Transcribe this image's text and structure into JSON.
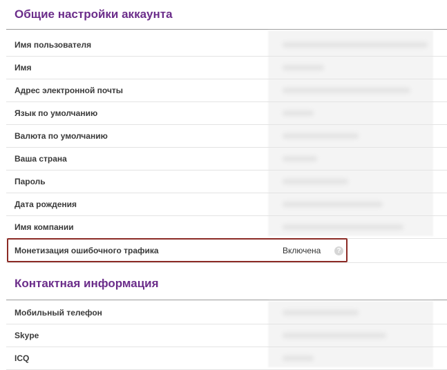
{
  "account_section": {
    "title": "Общие настройки аккаунта",
    "rows": [
      {
        "label": "Имя пользователя"
      },
      {
        "label": "Имя"
      },
      {
        "label": "Адрес электронной почты"
      },
      {
        "label": "Язык по умолчанию"
      },
      {
        "label": "Валюта по умолчанию"
      },
      {
        "label": "Ваша страна"
      },
      {
        "label": "Пароль"
      },
      {
        "label": "Дата рождения"
      },
      {
        "label": "Имя компании"
      },
      {
        "label": "Монетизация ошибочного трафика",
        "value": "Включена",
        "icon": "help-icon"
      }
    ]
  },
  "contact_section": {
    "title": "Контактная информация",
    "rows": [
      {
        "label": "Мобильный телефон"
      },
      {
        "label": "Skype"
      },
      {
        "label": "ICQ"
      }
    ]
  },
  "help_icon_glyph": "?",
  "colors": {
    "heading": "#6b2d8a",
    "highlight_border": "#8b2a24"
  }
}
